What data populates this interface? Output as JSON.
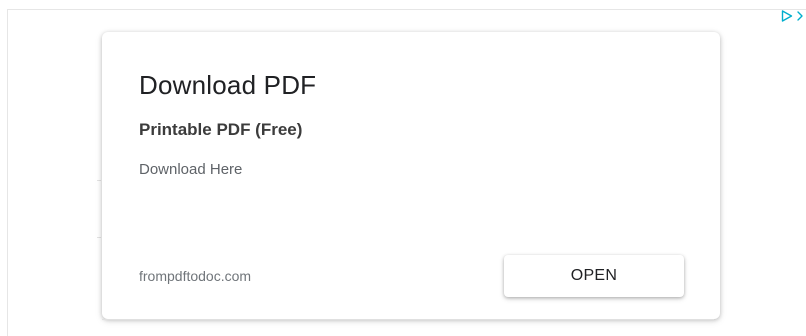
{
  "ad": {
    "headline": "Download PDF",
    "subheadline": "Printable PDF (Free)",
    "body_text": "Download Here",
    "display_url": "frompdftodoc.com",
    "cta_label": "OPEN"
  },
  "adchoices": {
    "icon": "adchoices-play-icon",
    "close_icon": "chevron-right-icon",
    "accent_color": "#00aecd"
  }
}
